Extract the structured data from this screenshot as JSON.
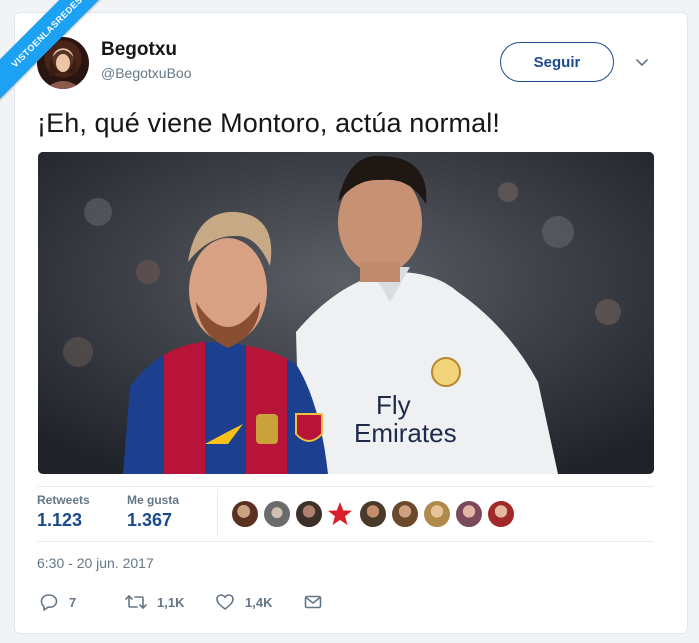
{
  "watermark": {
    "text": "VISTOENLASREDES"
  },
  "author": {
    "name": "Begotxu",
    "handle": "@BegotxuBoo"
  },
  "follow_button": {
    "label": "Seguir"
  },
  "tweet": {
    "text": "¡Eh, qué viene Montoro, actúa normal!",
    "image_label": "Fly Emirates"
  },
  "stats": {
    "retweets_label": "Retweets",
    "retweets_value": "1.123",
    "likes_label": "Me gusta",
    "likes_value": "1.367"
  },
  "timestamp": "6:30 - 20 jun. 2017",
  "actions": {
    "replies": "7",
    "retweets": "1,1K",
    "likes": "1,4K"
  },
  "colors": {
    "accent": "#1b4a8c",
    "twitter_blue": "#1da1f2",
    "muted": "#657786"
  }
}
